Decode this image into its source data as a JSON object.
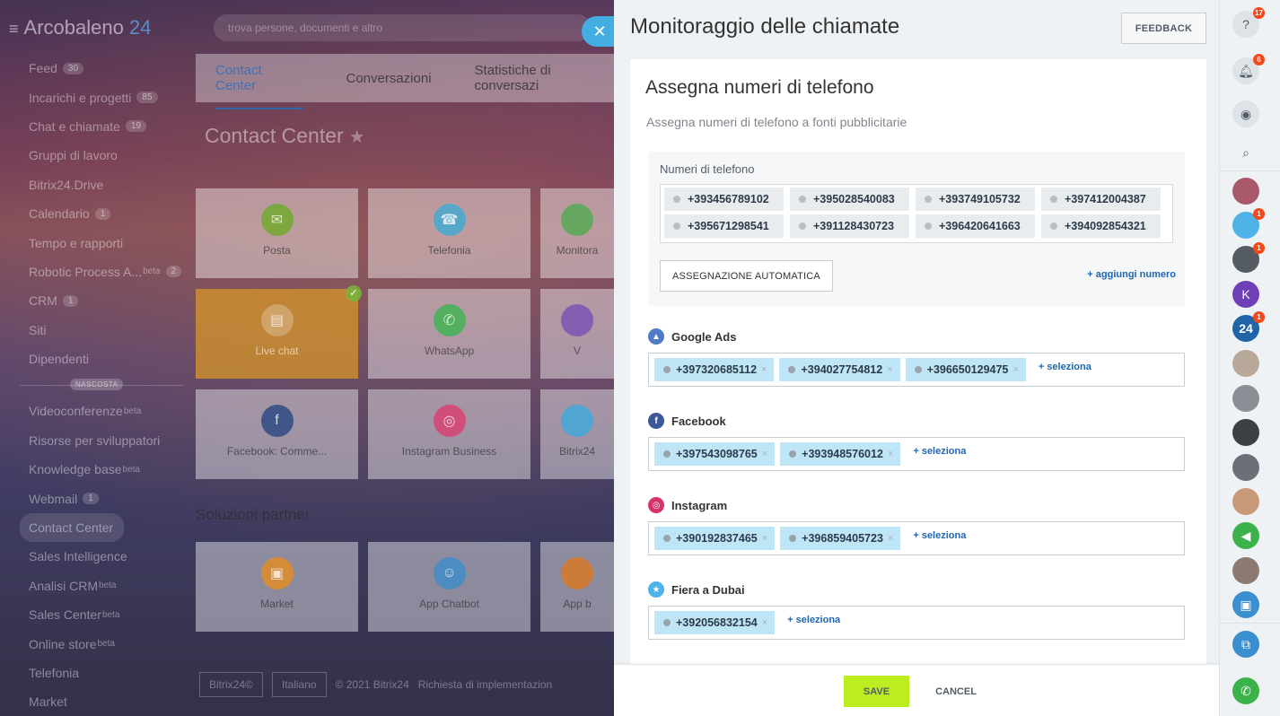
{
  "app": {
    "logo_name": "Arcobaleno",
    "logo_num": "24",
    "search_placeholder": "trova persone, documenti e altro"
  },
  "sidebar": {
    "items": [
      {
        "label": "Feed",
        "count": "30"
      },
      {
        "label": "Incarichi e progetti",
        "count": "85"
      },
      {
        "label": "Chat e chiamate",
        "count": "19"
      },
      {
        "label": "Gruppi di lavoro"
      },
      {
        "label": "Bitrix24.Drive"
      },
      {
        "label": "Calendario",
        "count": "1"
      },
      {
        "label": "Tempo e rapporti"
      },
      {
        "label": "Robotic Process A...",
        "sup": "beta",
        "count": "2"
      },
      {
        "label": "CRM",
        "count": "1"
      },
      {
        "label": "Siti"
      },
      {
        "label": "Dipendenti"
      }
    ],
    "separator_label": "NASCOSTA",
    "hidden_items": [
      {
        "label": "Videoconferenze",
        "sup": "beta"
      },
      {
        "label": "Risorse per sviluppatori"
      },
      {
        "label": "Knowledge base",
        "sup": "beta"
      },
      {
        "label": "Webmail",
        "count": "1"
      },
      {
        "label": "Contact Center",
        "active": true
      },
      {
        "label": "Sales Intelligence"
      },
      {
        "label": "Analisi CRM",
        "sup": "beta"
      },
      {
        "label": "Sales Center",
        "sup": "beta"
      },
      {
        "label": "Online store",
        "sup": "beta"
      },
      {
        "label": "Telefonia"
      },
      {
        "label": "Market"
      }
    ]
  },
  "main": {
    "tabs": [
      "Contact Center",
      "Conversazioni",
      "Statistiche di conversazi"
    ],
    "title": "Contact Center",
    "tiles_row1": [
      "Posta",
      "Telefonia",
      "Monitora"
    ],
    "tiles_row2": [
      "Live chat",
      "WhatsApp",
      "V"
    ],
    "tiles_row3": [
      "Facebook: Comme...",
      "Instagram Business",
      "Bitrix24"
    ],
    "partner_title": "Soluzioni partner",
    "tiles_row4": [
      "Market",
      "App Chatbot",
      "App b"
    ],
    "footer": {
      "brand": "Bitrix24©",
      "language": "Italiano",
      "copyright": "© 2021 Bitrix24",
      "link": "Richiesta di implementazion"
    }
  },
  "panel": {
    "title": "Monitoraggio delle chiamate",
    "feedback_label": "FEEDBACK",
    "card_heading": "Assegna numeri di telefono",
    "card_subtitle": "Assegna numeri di telefono a fonti pubblicitarie",
    "phones_label": "Numeri di telefono",
    "phones": [
      "+393456789102",
      "+395028540083",
      "+393749105732",
      "+397412004387",
      "+395671298541",
      "+391128430723",
      "+396420641663",
      "+394092854321"
    ],
    "auto_assign_label": "ASSEGNAZIONE AUTOMATICA",
    "add_number_label": "+ aggiungi numero",
    "select_label": "+ seleziona",
    "sources": [
      {
        "name": "Google Ads",
        "icon": "google-ads-icon",
        "color": "#4f7cc4",
        "numbers": [
          "+397320685112",
          "+394027754812",
          "+396650129475"
        ]
      },
      {
        "name": "Facebook",
        "icon": "facebook-icon",
        "color": "#3b5998",
        "numbers": [
          "+397543098765",
          "+393948576012"
        ]
      },
      {
        "name": "Instagram",
        "icon": "instagram-icon",
        "color": "#d6336c",
        "numbers": [
          "+390192837465",
          "+396859405723"
        ]
      },
      {
        "name": "Fiera a Dubai",
        "icon": "star-icon",
        "color": "#4fb3e8",
        "numbers": [
          "+392056832154"
        ]
      }
    ],
    "save_label": "SAVE",
    "cancel_label": "CANCEL"
  },
  "rightbar": {
    "help_badge": "17",
    "notifications_badge": "6",
    "avatar_badges": [
      "1",
      "1",
      "1"
    ],
    "avatar_letter": "K",
    "avatar_24": "24"
  }
}
